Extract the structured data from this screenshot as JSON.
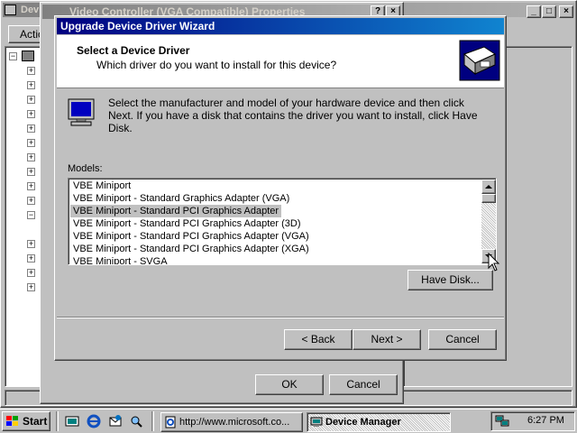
{
  "device_manager": {
    "title_partial": "Dev",
    "toolbar_action_partial": "Actio"
  },
  "properties_dialog": {
    "title": "Video Controller (VGA Compatible) Properties",
    "help_btn": "?",
    "close_btn": "×",
    "ok_label": "OK",
    "cancel_label": "Cancel"
  },
  "wizard": {
    "title": "Upgrade Device Driver Wizard",
    "header_title": "Select a Device Driver",
    "header_subtitle": "Which driver do you want to install for this device?",
    "instructions": "Select the manufacturer and model of your hardware device and then click Next. If you have a disk that contains the driver you want to install, click Have Disk.",
    "models_label": "Models:",
    "models": [
      "VBE Miniport",
      "VBE Miniport - Standard Graphics Adapter (VGA)",
      "VBE Miniport - Standard PCI Graphics Adapter",
      "VBE Miniport - Standard PCI Graphics Adapter (3D)",
      "VBE Miniport - Standard PCI Graphics Adapter (VGA)",
      "VBE Miniport - Standard PCI Graphics Adapter (XGA)",
      "VBE Miniport - SVGA"
    ],
    "selected_model": "VBE Miniport - Standard PCI Graphics Adapter",
    "have_disk_label": "Have Disk...",
    "back_label": "< Back",
    "next_label": "Next >",
    "cancel_label": "Cancel"
  },
  "taskbar": {
    "start_label": "Start",
    "ie_task": "http://www.microsoft.co...",
    "dm_task": "Device Manager",
    "clock": "6:27 PM"
  }
}
